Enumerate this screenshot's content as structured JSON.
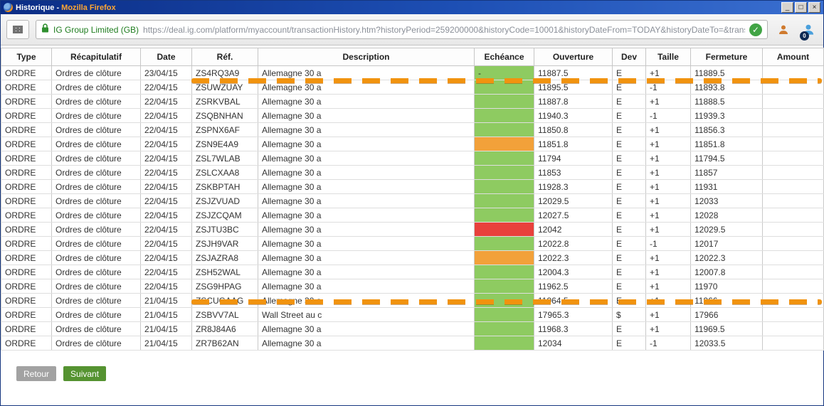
{
  "colors": {
    "green": "#8ecb61",
    "orange": "#f2a13a",
    "red": "#e8413c"
  },
  "window": {
    "title_prefix": "Historique - ",
    "title_suffix": "Mozilla Firefox"
  },
  "toolbar": {
    "site_identity": "IG Group Limited (GB)",
    "url": "https://deal.ig.com/platform/myaccount/transactionHistory.htm?historyPeriod=259200000&historyCode=10001&historyDateFrom=TODAY&historyDateTo=&transactionHistoryPageN",
    "badge_count": "0"
  },
  "table": {
    "columns": [
      "Type",
      "Récapitulatif",
      "Date",
      "Réf.",
      "Description",
      "Echéance",
      "Ouverture",
      "Dev",
      "Taille",
      "Fermeture",
      "Amount"
    ],
    "rows": [
      {
        "type": "ORDRE",
        "recap": "Ordres de clôture",
        "date": "23/04/15",
        "ref": "ZS4RQ3A9",
        "desc": "Allemagne 30 a",
        "echeance": "-",
        "echeance_color": "green",
        "ouverture": "11887.5",
        "dev": "E",
        "taille": "+1",
        "fermeture": "11889.5",
        "amount": ""
      },
      {
        "type": "ORDRE",
        "recap": "Ordres de clôture",
        "date": "22/04/15",
        "ref": "ZSUWZUAY",
        "desc": "Allemagne 30 a",
        "echeance": "",
        "echeance_color": "green",
        "ouverture": "11895.5",
        "dev": "E",
        "taille": "-1",
        "fermeture": "11893.8",
        "amount": ""
      },
      {
        "type": "ORDRE",
        "recap": "Ordres de clôture",
        "date": "22/04/15",
        "ref": "ZSRKVBAL",
        "desc": "Allemagne 30 a",
        "echeance": "",
        "echeance_color": "green",
        "ouverture": "11887.8",
        "dev": "E",
        "taille": "+1",
        "fermeture": "11888.5",
        "amount": ""
      },
      {
        "type": "ORDRE",
        "recap": "Ordres de clôture",
        "date": "22/04/15",
        "ref": "ZSQBNHAN",
        "desc": "Allemagne 30 a",
        "echeance": "",
        "echeance_color": "green",
        "ouverture": "11940.3",
        "dev": "E",
        "taille": "-1",
        "fermeture": "11939.3",
        "amount": ""
      },
      {
        "type": "ORDRE",
        "recap": "Ordres de clôture",
        "date": "22/04/15",
        "ref": "ZSPNX6AF",
        "desc": "Allemagne 30 a",
        "echeance": "",
        "echeance_color": "green",
        "ouverture": "11850.8",
        "dev": "E",
        "taille": "+1",
        "fermeture": "11856.3",
        "amount": ""
      },
      {
        "type": "ORDRE",
        "recap": "Ordres de clôture",
        "date": "22/04/15",
        "ref": "ZSN9E4A9",
        "desc": "Allemagne 30 a",
        "echeance": "",
        "echeance_color": "orange",
        "ouverture": "11851.8",
        "dev": "E",
        "taille": "+1",
        "fermeture": "11851.8",
        "amount": ""
      },
      {
        "type": "ORDRE",
        "recap": "Ordres de clôture",
        "date": "22/04/15",
        "ref": "ZSL7WLAB",
        "desc": "Allemagne 30 a",
        "echeance": "",
        "echeance_color": "green",
        "ouverture": "11794",
        "dev": "E",
        "taille": "+1",
        "fermeture": "11794.5",
        "amount": ""
      },
      {
        "type": "ORDRE",
        "recap": "Ordres de clôture",
        "date": "22/04/15",
        "ref": "ZSLCXAA8",
        "desc": "Allemagne 30 a",
        "echeance": "",
        "echeance_color": "green",
        "ouverture": "11853",
        "dev": "E",
        "taille": "+1",
        "fermeture": "11857",
        "amount": ""
      },
      {
        "type": "ORDRE",
        "recap": "Ordres de clôture",
        "date": "22/04/15",
        "ref": "ZSKBPTAH",
        "desc": "Allemagne 30 a",
        "echeance": "",
        "echeance_color": "green",
        "ouverture": "11928.3",
        "dev": "E",
        "taille": "+1",
        "fermeture": "11931",
        "amount": ""
      },
      {
        "type": "ORDRE",
        "recap": "Ordres de clôture",
        "date": "22/04/15",
        "ref": "ZSJZVUAD",
        "desc": "Allemagne 30 a",
        "echeance": "",
        "echeance_color": "green",
        "ouverture": "12029.5",
        "dev": "E",
        "taille": "+1",
        "fermeture": "12033",
        "amount": ""
      },
      {
        "type": "ORDRE",
        "recap": "Ordres de clôture",
        "date": "22/04/15",
        "ref": "ZSJZCQAM",
        "desc": "Allemagne 30 a",
        "echeance": "",
        "echeance_color": "green",
        "ouverture": "12027.5",
        "dev": "E",
        "taille": "+1",
        "fermeture": "12028",
        "amount": ""
      },
      {
        "type": "ORDRE",
        "recap": "Ordres de clôture",
        "date": "22/04/15",
        "ref": "ZSJTU3BC",
        "desc": "Allemagne 30 a",
        "echeance": "",
        "echeance_color": "red",
        "ouverture": "12042",
        "dev": "E",
        "taille": "+1",
        "fermeture": "12029.5",
        "amount": ""
      },
      {
        "type": "ORDRE",
        "recap": "Ordres de clôture",
        "date": "22/04/15",
        "ref": "ZSJH9VAR",
        "desc": "Allemagne 30 a",
        "echeance": "",
        "echeance_color": "green",
        "ouverture": "12022.8",
        "dev": "E",
        "taille": "-1",
        "fermeture": "12017",
        "amount": ""
      },
      {
        "type": "ORDRE",
        "recap": "Ordres de clôture",
        "date": "22/04/15",
        "ref": "ZSJAZRA8",
        "desc": "Allemagne 30 a",
        "echeance": "",
        "echeance_color": "orange",
        "ouverture": "12022.3",
        "dev": "E",
        "taille": "+1",
        "fermeture": "12022.3",
        "amount": ""
      },
      {
        "type": "ORDRE",
        "recap": "Ordres de clôture",
        "date": "22/04/15",
        "ref": "ZSH52WAL",
        "desc": "Allemagne 30 a",
        "echeance": "",
        "echeance_color": "green",
        "ouverture": "12004.3",
        "dev": "E",
        "taille": "+1",
        "fermeture": "12007.8",
        "amount": ""
      },
      {
        "type": "ORDRE",
        "recap": "Ordres de clôture",
        "date": "22/04/15",
        "ref": "ZSG9HPAG",
        "desc": "Allemagne 30 a",
        "echeance": "",
        "echeance_color": "green",
        "ouverture": "11962.5",
        "dev": "E",
        "taille": "+1",
        "fermeture": "11970",
        "amount": ""
      },
      {
        "type": "ORDRE",
        "recap": "Ordres de clôture",
        "date": "21/04/15",
        "ref": "ZSCUGAAG",
        "desc": "Allemagne 30 a",
        "echeance": "",
        "echeance_color": "green",
        "ouverture": "11964.5",
        "dev": "E",
        "taille": "+1",
        "fermeture": "11966",
        "amount": ""
      },
      {
        "type": "ORDRE",
        "recap": "Ordres de clôture",
        "date": "21/04/15",
        "ref": "ZSBVV7AL",
        "desc": "Wall Street au c",
        "echeance": "",
        "echeance_color": "green",
        "ouverture": "17965.3",
        "dev": "$",
        "taille": "+1",
        "fermeture": "17966",
        "amount": ""
      },
      {
        "type": "ORDRE",
        "recap": "Ordres de clôture",
        "date": "21/04/15",
        "ref": "ZR8J84A6",
        "desc": "Allemagne 30 a",
        "echeance": "",
        "echeance_color": "green",
        "ouverture": "11968.3",
        "dev": "E",
        "taille": "+1",
        "fermeture": "11969.5",
        "amount": ""
      },
      {
        "type": "ORDRE",
        "recap": "Ordres de clôture",
        "date": "21/04/15",
        "ref": "ZR7B62AN",
        "desc": "Allemagne 30 a",
        "echeance": "",
        "echeance_color": "green",
        "ouverture": "12034",
        "dev": "E",
        "taille": "-1",
        "fermeture": "12033.5",
        "amount": ""
      }
    ]
  },
  "footer": {
    "back_label": "Retour",
    "next_label": "Suivant"
  }
}
